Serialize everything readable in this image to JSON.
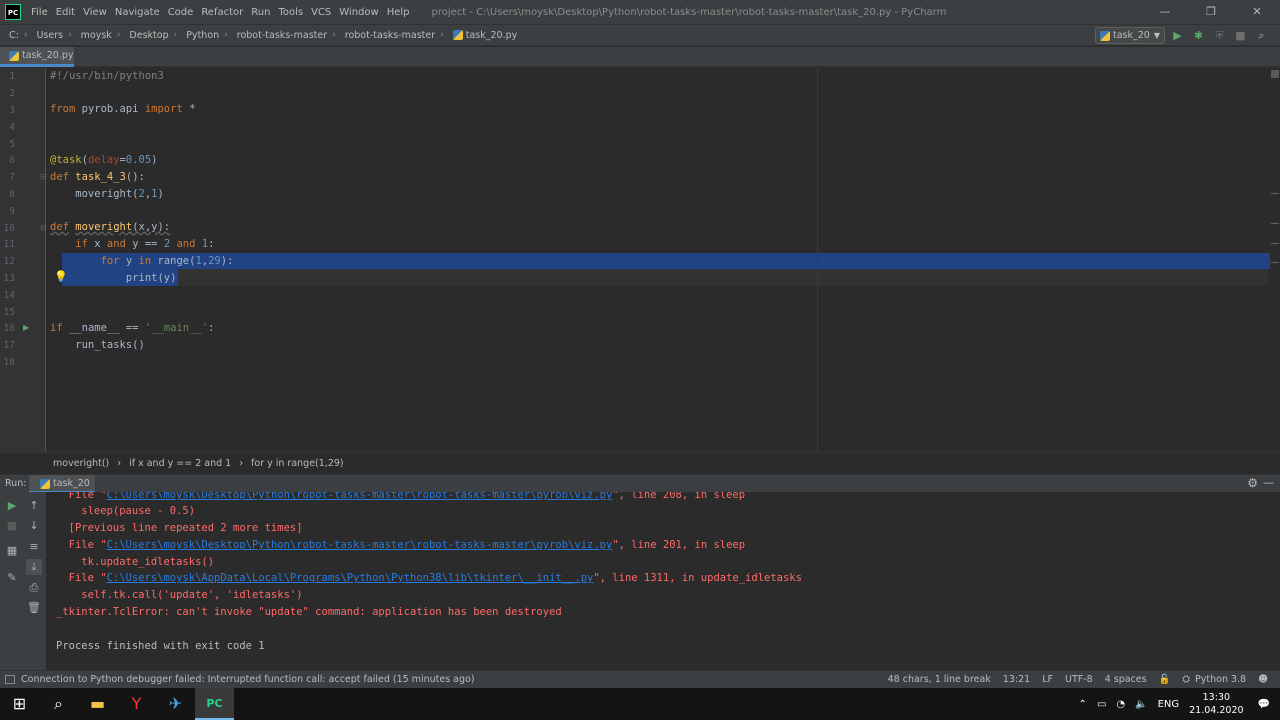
{
  "titlebar": {
    "menu": [
      "File",
      "Edit",
      "View",
      "Navigate",
      "Code",
      "Refactor",
      "Run",
      "Tools",
      "VCS",
      "Window",
      "Help"
    ],
    "title": "project - C:\\Users\\moysk\\Desktop\\Python\\robot-tasks-master\\robot-tasks-master\\task_20.py - PyCharm"
  },
  "navbar": {
    "crumbs": [
      "C:",
      "Users",
      "moysk",
      "Desktop",
      "Python",
      "robot-tasks-master",
      "robot-tasks-master",
      "task_20.py"
    ],
    "run_config": "task_20"
  },
  "editor": {
    "tab": "task_20.py",
    "line_numbers": [
      "1",
      "2",
      "3",
      "4",
      "5",
      "6",
      "7",
      "8",
      "9",
      "10",
      "11",
      "12",
      "13",
      "14",
      "15",
      "16",
      "17",
      "18"
    ],
    "breadcrumbs": [
      "moveright()",
      "if x and y == 2 and 1",
      "for y in range(1,29)"
    ]
  },
  "run": {
    "label": "Run:",
    "tab": "task_20",
    "output": {
      "l1a": "  File \"",
      "l1b": "C:\\Users\\moysk\\Desktop\\Python\\robot-tasks-master\\robot-tasks-master\\pyrob\\viz.py",
      "l1c": "\", line 208, in sleep",
      "l2": "    sleep(pause - 0.5)",
      "l3": "  [Previous line repeated 2 more times]",
      "l4a": "  File \"",
      "l4b": "C:\\Users\\moysk\\Desktop\\Python\\robot-tasks-master\\robot-tasks-master\\pyrob\\viz.py",
      "l4c": "\", line 201, in sleep",
      "l5": "    tk.update_idletasks()",
      "l6a": "  File \"",
      "l6b": "C:\\Users\\moysk\\AppData\\Local\\Programs\\Python\\Python38\\lib\\tkinter\\__init__.py",
      "l6c": "\", line 1311, in update_idletasks",
      "l7": "    self.tk.call('update', 'idletasks')",
      "l8": "_tkinter.TclError: can't invoke \"update\" command: application has been destroyed",
      "l9": "Process finished with exit code 1"
    }
  },
  "statusbar": {
    "message": "Connection to Python debugger failed: Interrupted function call: accept failed (15 minutes ago)",
    "chars": "48 chars, 1 line break",
    "position": "13:21",
    "line_sep": "LF",
    "encoding": "UTF-8",
    "indent": "4 spaces",
    "interpreter": "Python 3.8"
  },
  "taskbar": {
    "lang": "ENG",
    "time": "13:30",
    "date": "21.04.2020"
  }
}
